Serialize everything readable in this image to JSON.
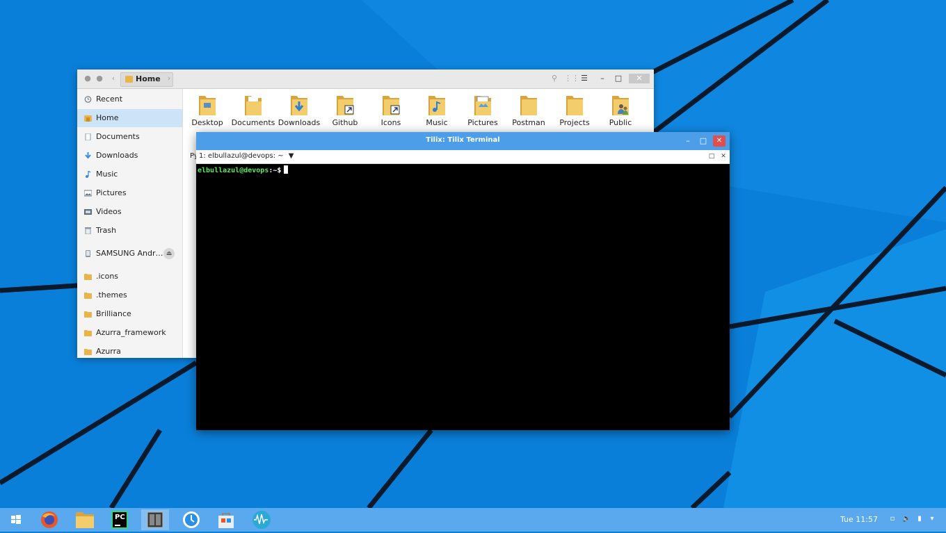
{
  "desktop": {
    "background_color": "#0a7fd9",
    "line_color": "#081a2b"
  },
  "file_manager": {
    "breadcrumb": "Home",
    "sidebar": [
      {
        "label": "Recent",
        "icon": "clock-icon"
      },
      {
        "label": "Home",
        "icon": "home-icon",
        "active": true
      },
      {
        "label": "Documents",
        "icon": "document-icon"
      },
      {
        "label": "Downloads",
        "icon": "download-icon"
      },
      {
        "label": "Music",
        "icon": "music-note-icon"
      },
      {
        "label": "Pictures",
        "icon": "picture-icon"
      },
      {
        "label": "Videos",
        "icon": "video-icon"
      },
      {
        "label": "Trash",
        "icon": "trash-icon"
      },
      {
        "label": "SAMSUNG Andr…",
        "icon": "phone-icon",
        "eject": true
      },
      {
        "label": ".icons",
        "icon": "folder-icon"
      },
      {
        "label": ".themes",
        "icon": "folder-icon"
      },
      {
        "label": "Brilliance",
        "icon": "folder-icon"
      },
      {
        "label": "Azurra_framework",
        "icon": "folder-icon"
      },
      {
        "label": "Azurra",
        "icon": "folder-icon"
      }
    ],
    "folders": [
      "Desktop",
      "Documents",
      "Downloads",
      "Github",
      "Icons",
      "Music",
      "Pictures",
      "Postman",
      "Projects",
      "Public"
    ],
    "peek_text": "Py"
  },
  "terminal": {
    "title": "Tilix: Tilix Terminal",
    "session": "1: elbullazul@devops: ~",
    "prompt_user": "elbullazul@devops",
    "prompt_path": ":~$",
    "prompt_color": "#5ee85e"
  },
  "taskbar": {
    "clock": "Tue 11:57",
    "apps": [
      "start-menu-icon",
      "firefox-icon",
      "file-manager-icon",
      "pycharm-icon",
      "tilix-icon",
      "timeshift-icon",
      "software-store-icon",
      "audio-recorder-icon"
    ],
    "pycharm_label": "PC"
  }
}
